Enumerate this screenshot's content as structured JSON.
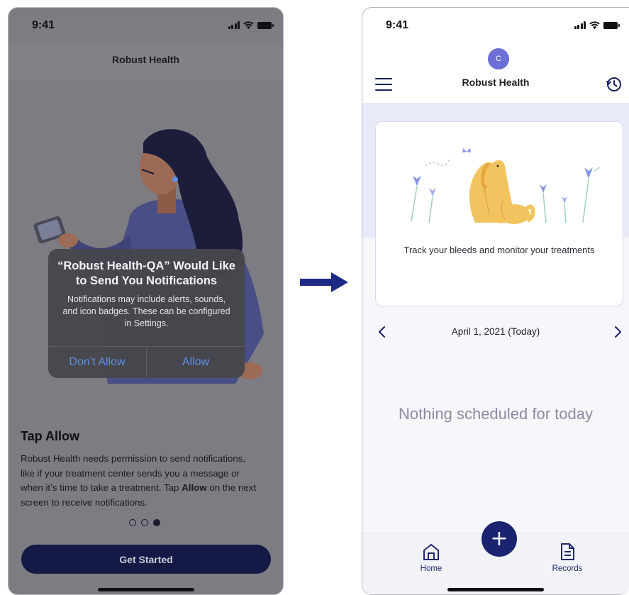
{
  "left_screen": {
    "status_time": "9:41",
    "header_title": "Robust Health",
    "alert": {
      "title": "“Robust Health-QA” Would Like to Send You Notifications",
      "message": "Notifications may include alerts, sounds, and icon badges. These can be configured in Settings.",
      "deny_label": "Don’t Allow",
      "allow_label": "Allow"
    },
    "onboarding": {
      "heading": "Tap Allow",
      "description_before": "Robust Health needs permission to send notifications, like if your treatment center sends you a message or when it’s time to take a treatment. Tap ",
      "description_bold": "Allow",
      "description_after": " on the next screen to receive notifications.",
      "page_count": 3,
      "current_page": 3,
      "cta_label": "Get Started"
    }
  },
  "transition_arrow_icon": "right-arrow-icon",
  "right_screen": {
    "status_time": "9:41",
    "avatar_initial": "C",
    "header_title": "Robust Health",
    "card": {
      "illustration": "dog-with-flowers",
      "text": "Track your bleeds and monitor your treatments"
    },
    "date_label": "April 1, 2021 (Today)",
    "empty_state": "Nothing scheduled for today",
    "tabs": [
      {
        "label": "Home",
        "icon": "home-icon"
      },
      {
        "label": "Records",
        "icon": "document-icon"
      }
    ],
    "fab_icon": "plus-icon"
  },
  "colors": {
    "primary": "#1a2370",
    "avatar": "#6c6fd6",
    "alert_button": "#5e90e6",
    "band": "#e8eaf9"
  }
}
